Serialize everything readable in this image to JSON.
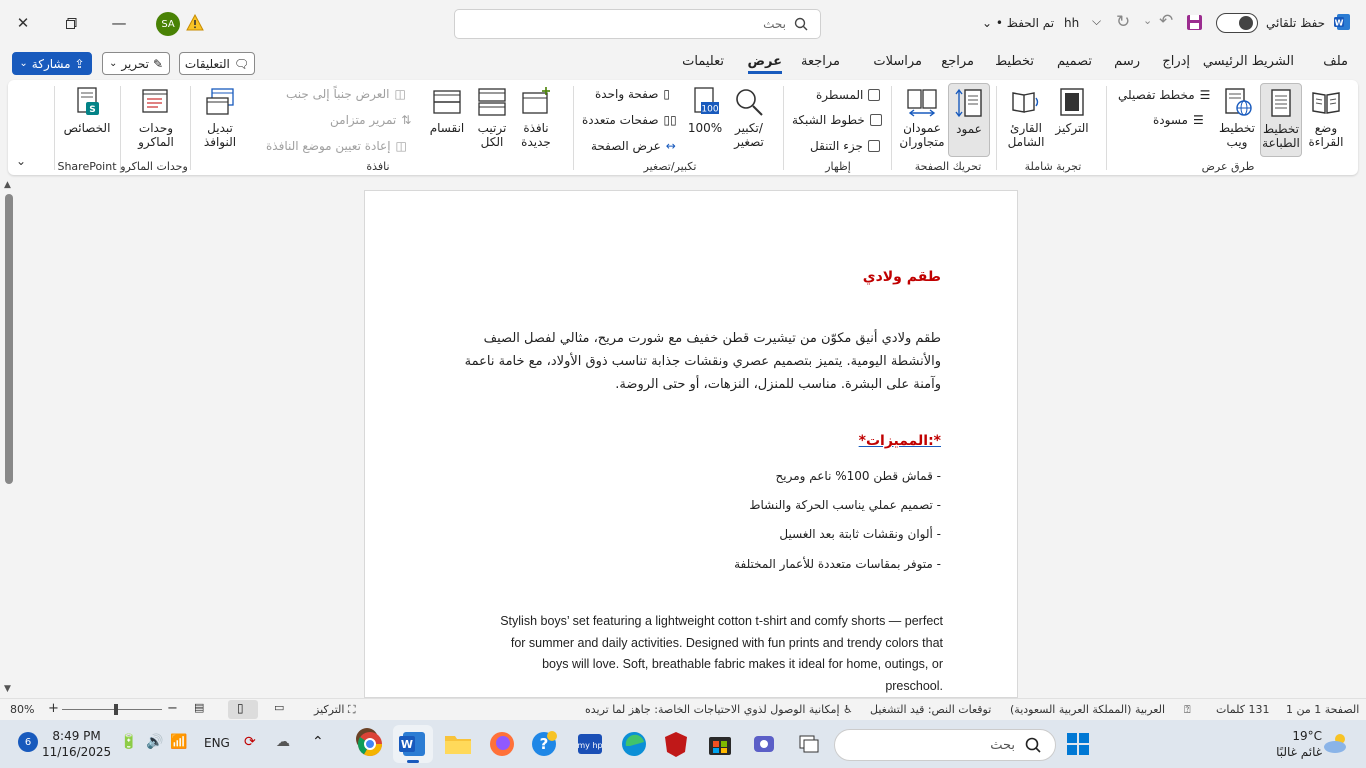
{
  "titlebar": {
    "app_name": "hh",
    "save_state": "• تم الحفظ",
    "autosave_label": "حفظ تلقائي",
    "search_placeholder": "بحث",
    "user_initials": "SA"
  },
  "tabs": [
    "ملف",
    "الشريط الرئيسي",
    "إدراج",
    "رسم",
    "تصميم",
    "تخطيط",
    "مراجع",
    "مراسلات",
    "مراجعة",
    "عرض",
    "تعليمات"
  ],
  "active_tab": "عرض",
  "top_buttons": {
    "comments": "التعليقات",
    "editing": "تحرير",
    "share": "مشاركة"
  },
  "ribbon": {
    "views": {
      "group_label": "طرق عرض",
      "read_mode": "وضع\nالقراءة",
      "print_layout": "تخطيط\nالطباعة",
      "web_layout": "تخطيط\nويب",
      "outline": "مخطط تفصيلي",
      "draft": "مسودة"
    },
    "immersive": {
      "group_label": "تجربة شاملة",
      "focus": "التركيز",
      "immersive_reader": "القارئ\nالشامل"
    },
    "page_movement": {
      "group_label": "تحريك الصفحة",
      "vertical": "عمود",
      "side_by_side": "عمودان\nمتجاوران"
    },
    "show": {
      "group_label": "إظهار",
      "ruler": "المسطرة",
      "gridlines": "خطوط الشبكة",
      "nav_pane": "جزء التنقل"
    },
    "zoom": {
      "group_label": "تكبير/تصغير",
      "zoom": "تكبير/\nتصغير",
      "hundred": "100%",
      "hundred_icon": "100",
      "one_page": "صفحة واحدة",
      "multiple_pages": "صفحات متعددة",
      "page_width": "عرض الصفحة"
    },
    "window": {
      "group_label": "نافذة",
      "new_window": "نافذة\nجديدة",
      "arrange_all": "ترتيب\nالكل",
      "split": "انقسام",
      "side_by_side": "العرض جنباً إلى جنب",
      "sync_scroll": "تمرير متزامن",
      "reset_pos": "إعادة تعيين موضع النافذة",
      "switch_windows": "تبديل\nالنوافذ"
    },
    "macros": {
      "group_label": "وحدات الماكرو",
      "macros": "وحدات\nالماكرو"
    },
    "sharepoint": {
      "group_label": "SharePoint",
      "properties": "الخصائص"
    }
  },
  "document": {
    "heading": "طقم ولادي",
    "arabic_lines": [
      "طقم ولادي أنيق مكوّن من تيشيرت قطن خفيف مع شورت مريح، مثالي لفصل الصيف",
      "والأنشطة اليومية. يتميز بتصميم عصري ونقشات جذابة تناسب ذوق الأولاد، مع خامة ناعمة",
      "وآمنة على البشرة. مناسب للمنزل، النزهات، أو حتى الروضة."
    ],
    "features_title": "*:المميزات*",
    "features": [
      "- قماش قطن 100% ناعم ومريح",
      "- تصميم عملي يناسب الحركة والنشاط",
      "- ألوان ونقشات ثابتة بعد الغسيل",
      "- متوفر بمقاسات متعددة للأعمار المختلفة"
    ],
    "english_lines": [
      "Stylish boys’ set featuring a lightweight cotton t-shirt and comfy shorts — perfect",
      "for summer and daily activities. Designed with fun prints and trendy colors that",
      "boys will love. Soft, breathable fabric makes it ideal for home, outings, or",
      "preschool."
    ]
  },
  "statusbar": {
    "page": "الصفحة 1 من 1",
    "words": "131 كلمات",
    "language": "العربية (المملكة العربية السعودية)",
    "predictions": "توقعات النص: قيد التشغيل",
    "accessibility": "إمكانية الوصول لذوي الاحتياجات الخاصة: جاهز لما تريده",
    "focus": "التركيز",
    "zoom": "80%",
    "zoom_fraction": 0.8
  },
  "taskbar": {
    "weather_temp": "19°C",
    "weather_desc": "غائم غالبًا",
    "search": "بحث",
    "lang": "ENG",
    "time": "8:49 PM",
    "date": "11/16/2025",
    "notif_count": "6"
  },
  "colors": {
    "accent": "#185abd",
    "heading_red": "#c00000",
    "avatar_green": "#498205",
    "word_blue": "#2b579a",
    "autosave_purple": "#9b2c8f"
  }
}
